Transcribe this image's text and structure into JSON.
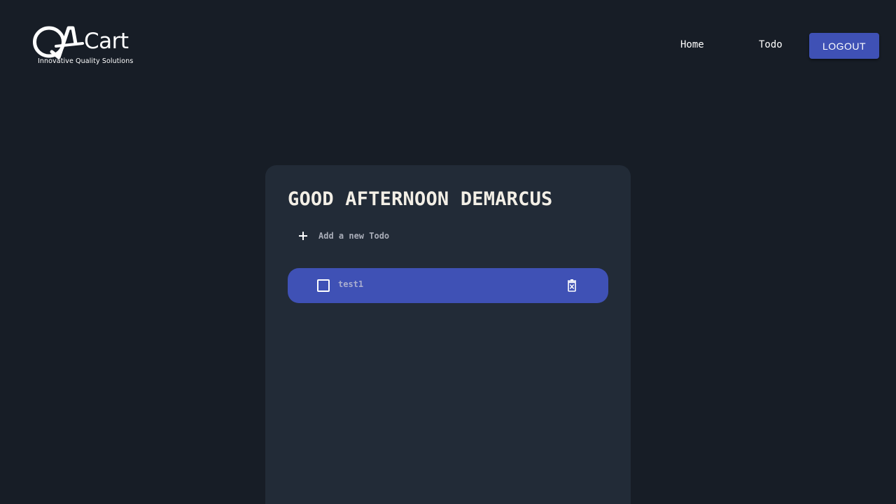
{
  "header": {
    "logo": {
      "brand_mark": "QA",
      "brand_name": "Cart",
      "tagline": "Innovative Quality Solutions"
    },
    "nav": {
      "home_label": "Home",
      "todo_label": "Todo",
      "logout_label": "LOGOUT"
    }
  },
  "main": {
    "greeting": "GOOD AFTERNOON DEMARCUS",
    "new_todo": {
      "placeholder": "Add a new Todo",
      "value": ""
    },
    "todos": [
      {
        "text": "test1",
        "completed": false
      }
    ]
  },
  "icons": {
    "add": "plus-icon",
    "checkbox": "checkbox-icon",
    "delete": "trash-icon"
  },
  "colors": {
    "background": "#171d26",
    "card": "#222b37",
    "accent": "#3f51b5",
    "greeting_text": "#f3efe6"
  }
}
